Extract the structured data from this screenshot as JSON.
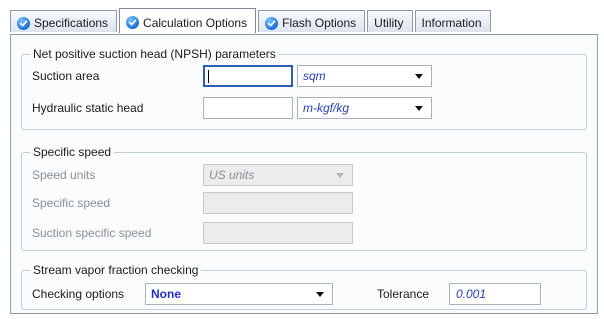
{
  "tabs": [
    {
      "label": "Specifications",
      "icon": "check-circle-icon",
      "active": false
    },
    {
      "label": "Calculation Options",
      "icon": "check-circle-icon",
      "active": true
    },
    {
      "label": "Flash Options",
      "icon": "check-circle-icon",
      "active": false
    },
    {
      "label": "Utility",
      "icon": null,
      "active": false
    },
    {
      "label": "Information",
      "icon": null,
      "active": false
    }
  ],
  "npsh": {
    "title": "Net positive suction head (NPSH) parameters",
    "suction_area": {
      "label": "Suction area",
      "value": "",
      "unit": "sqm"
    },
    "hydraulic_static_head": {
      "label": "Hydraulic static head",
      "value": "",
      "unit": "m-kgf/kg"
    }
  },
  "specific_speed": {
    "title": "Specific speed",
    "speed_units": {
      "label": "Speed units",
      "value": "US units"
    },
    "specific_speed": {
      "label": "Specific speed",
      "value": ""
    },
    "suction_specific_speed": {
      "label": "Suction specific speed",
      "value": ""
    }
  },
  "vapor": {
    "title": "Stream vapor fraction checking",
    "checking_options": {
      "label": "Checking options",
      "value": "None"
    },
    "tolerance": {
      "label": "Tolerance",
      "value": "0.001"
    }
  },
  "colors": {
    "accent": "#2b5fb5",
    "unit_text": "#2742b0",
    "disabled_text": "#8a8f96",
    "tab_icon": "#1a6fd3"
  }
}
